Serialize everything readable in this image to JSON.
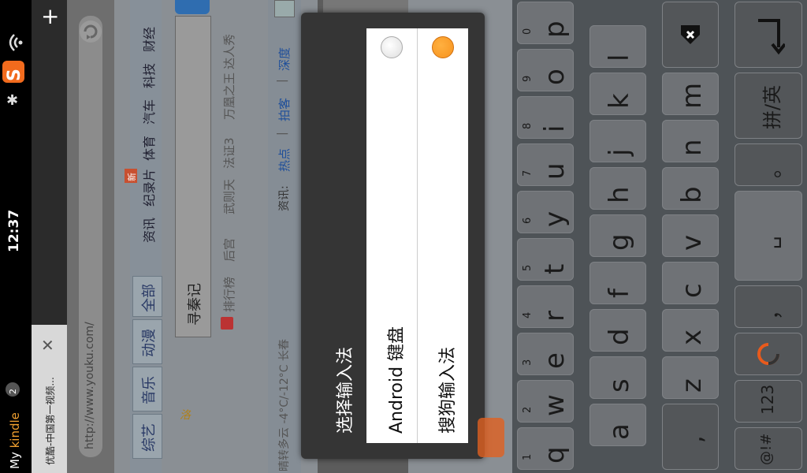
{
  "status_bar": {
    "time": "12:37",
    "app_icon": "sogou-s-icon",
    "my_label": "My",
    "kindle_label": "kindle",
    "notification_count": "2",
    "colors": {
      "kindle": "#f0a030",
      "sogou": "#f26b1d"
    }
  },
  "tabs": {
    "active_tab_title": "优酷-中国第一视频...",
    "close_symbol": "✕",
    "add_symbol": "+"
  },
  "url_bar": {
    "url": "http://www.youku.com/"
  },
  "web_page": {
    "nav": [
      "综艺",
      "音乐",
      "动漫",
      "全部",
      "资讯",
      "纪录片",
      "体育",
      "汽车",
      "科技",
      "财经"
    ],
    "new_badge": "新",
    "search_value": "寻秦记",
    "hot_list": [
      "排行榜",
      "后宫",
      "武则天",
      "法证3",
      "万凰之王",
      "达人秀"
    ],
    "weather": "晴转多云 -4°C/-12°C 长春",
    "news_label": "资讯:",
    "news_links": [
      "热点",
      "拍客",
      "深度"
    ],
    "news_separator": "|"
  },
  "dialog": {
    "title": "选择输入法",
    "options": [
      {
        "label": "Android 键盘",
        "selected": false
      },
      {
        "label": "搜狗输入法",
        "selected": true
      }
    ],
    "selected_color": "#f7931e"
  },
  "keyboard": {
    "row1": [
      {
        "letter": "q",
        "digit": "1"
      },
      {
        "letter": "w",
        "digit": "2"
      },
      {
        "letter": "e",
        "digit": "3"
      },
      {
        "letter": "r",
        "digit": "4"
      },
      {
        "letter": "t",
        "digit": "5"
      },
      {
        "letter": "y",
        "digit": "6"
      },
      {
        "letter": "u",
        "digit": "7"
      },
      {
        "letter": "i",
        "digit": "8"
      },
      {
        "letter": "o",
        "digit": "9"
      },
      {
        "letter": "p",
        "digit": "0"
      }
    ],
    "row2": [
      "a",
      "s",
      "d",
      "f",
      "g",
      "h",
      "j",
      "k",
      "l"
    ],
    "row3": [
      ",",
      "z",
      "x",
      "c",
      "v",
      "b",
      "n",
      "m"
    ],
    "bottom": {
      "symbols": "@!#",
      "numbers": "123",
      "comma": "，",
      "space": "␣",
      "period": "。",
      "lang_switch": "拼/英"
    }
  }
}
